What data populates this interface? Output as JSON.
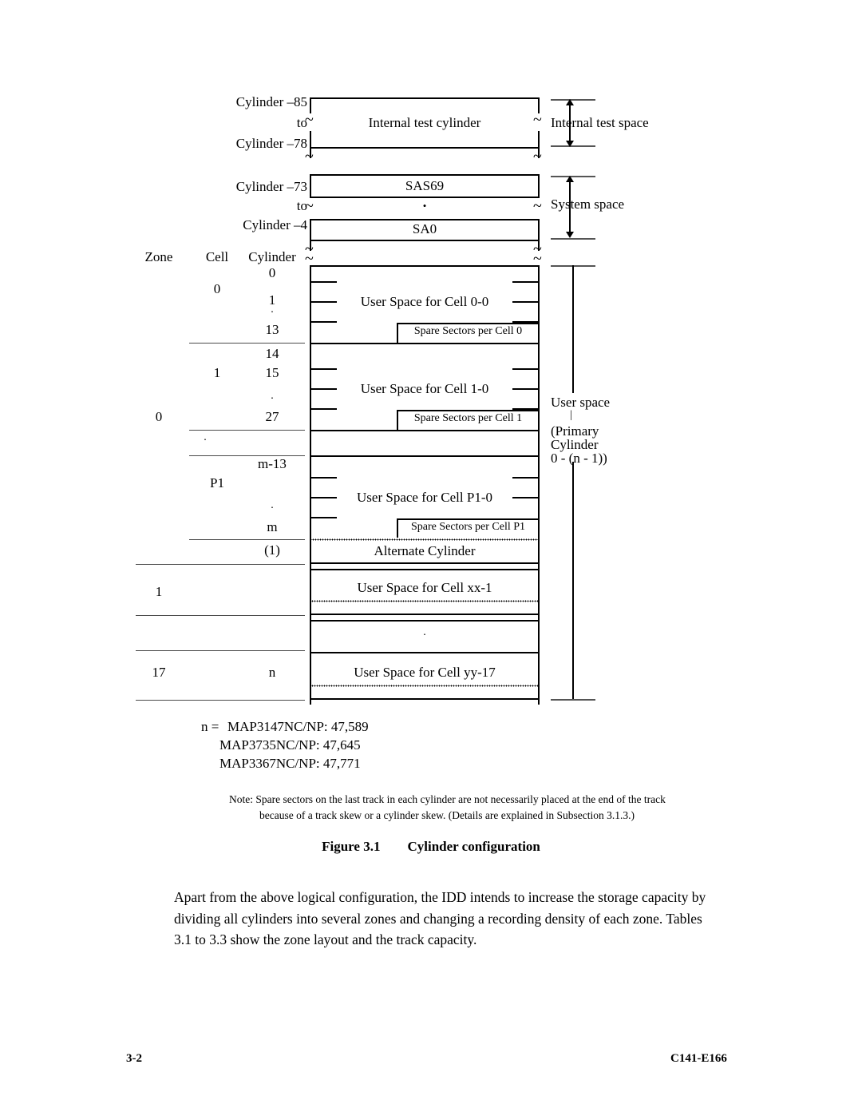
{
  "page": {
    "footer_left": "3-2",
    "footer_right": "C141-E166"
  },
  "figure": {
    "caption_number": "Figure 3.1",
    "caption_title": "Cylinder configuration",
    "column_headers": {
      "zone": "Zone",
      "cell": "Cell",
      "cylinder": "Cylinder"
    },
    "internal_test": {
      "range_line1": "Cylinder –85",
      "range_line2": "to",
      "range_line3": "Cylinder –78",
      "box_label": "Internal test cylinder",
      "space_label": "Internal test space"
    },
    "system": {
      "range_line1": "Cylinder –73",
      "range_line2": "to",
      "range_line3": "Cylinder –4",
      "box_top_label": "SAS69",
      "box_mid_label": "•",
      "box_bottom_label": "SA0",
      "space_label": "System space"
    },
    "user_space_bracket": {
      "line1": "User space",
      "line2": "|",
      "line3": "(Primary",
      "line4": "Cylinder",
      "line5": "0 - (n - 1))"
    },
    "cells": [
      {
        "cell": "0",
        "cylinders": [
          "0",
          "1",
          ".",
          "13"
        ],
        "user_space": "User Space for Cell 0-0",
        "spare": "Spare Sectors per Cell 0"
      },
      {
        "cell": "1",
        "cylinders": [
          "14",
          "15",
          ".",
          "27"
        ],
        "user_space": "User Space for Cell 1-0",
        "spare": "Spare Sectors per Cell 1"
      },
      {
        "cell": "P1",
        "cylinders": [
          "m-13",
          "",
          ".",
          "m"
        ],
        "user_space": "User Space for Cell P1-0",
        "spare": "Spare Sectors per Cell P1"
      }
    ],
    "zone_labels": {
      "zone0": "0",
      "zone1": "1",
      "zone17": "17",
      "ellipsis": "."
    },
    "alternate": {
      "cylinder_count": "(1)",
      "label": "Alternate Cylinder"
    },
    "zone1_block": {
      "user_space": "User Space for Cell xx-1"
    },
    "middle_ellipsis": ".",
    "zone17_block": {
      "cylinder": "n",
      "user_space": "User Space for Cell yy-17"
    },
    "n_values": {
      "prefix": "n =",
      "rows": [
        "MAP3147NC/NP: 47,589",
        "MAP3735NC/NP: 47,645",
        "MAP3367NC/NP: 47,771"
      ]
    },
    "note": {
      "line1": "Note: Spare sectors on the last track in each cylinder are not necessarily placed at the end of the track",
      "line2": "because of a track skew or a cylinder skew. (Details are explained in Subsection 3.1.3.)"
    }
  },
  "body_text": {
    "paragraph": "Apart from the above logical configuration, the IDD intends to increase the storage capacity by dividing all cylinders into several zones and changing a recording density of each zone.  Tables 3.1 to 3.3 show the zone layout and the track capacity."
  }
}
